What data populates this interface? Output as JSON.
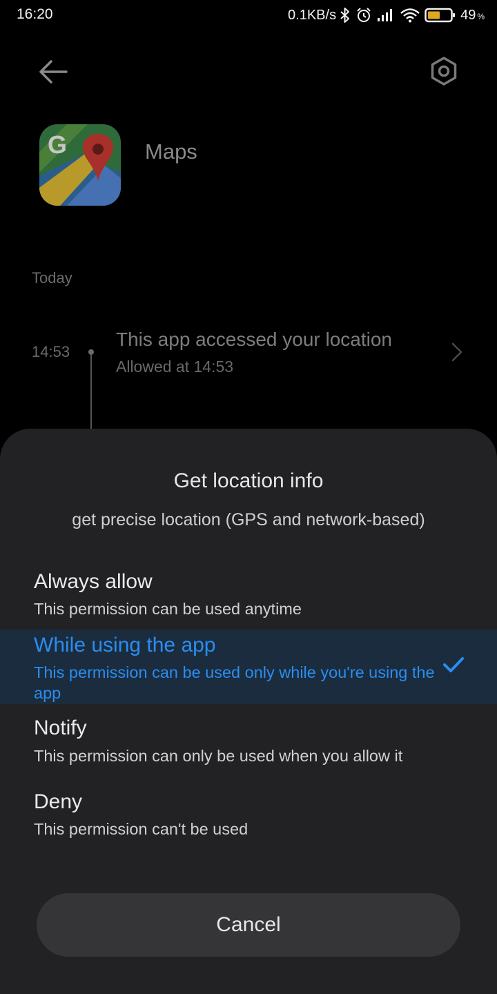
{
  "status_bar": {
    "time": "16:20",
    "net_speed": "0.1KB/s",
    "battery_percent": "49",
    "battery_unit": "%",
    "icons": [
      "bluetooth-icon",
      "alarm-icon",
      "signal-icon",
      "wifi-icon",
      "battery-icon"
    ]
  },
  "header": {
    "back_icon": "arrow-left-icon",
    "settings_icon": "hexagon-settings-icon"
  },
  "app": {
    "name": "Maps",
    "icon": "google-maps-icon"
  },
  "history": {
    "day_label": "Today",
    "events": [
      {
        "time": "14:53",
        "title": "This app accessed your location",
        "subtitle": "Allowed at 14:53"
      }
    ]
  },
  "sheet": {
    "title": "Get location info",
    "subtitle": "get precise location (GPS and network-based)",
    "options": [
      {
        "title": "Always allow",
        "desc": "This permission can be used anytime",
        "selected": false
      },
      {
        "title": "While using the app",
        "desc": "This permission can be used only while you're using the app",
        "selected": true
      },
      {
        "title": "Notify",
        "desc": "This permission can only be used when you allow it",
        "selected": false
      },
      {
        "title": "Deny",
        "desc": "This permission can't be used",
        "selected": false
      }
    ],
    "cancel_label": "Cancel"
  },
  "colors": {
    "accent": "#2a8df0",
    "sheet_bg": "#222224",
    "selected_bg": "#1b2c3e",
    "cancel_bg": "#353537"
  }
}
